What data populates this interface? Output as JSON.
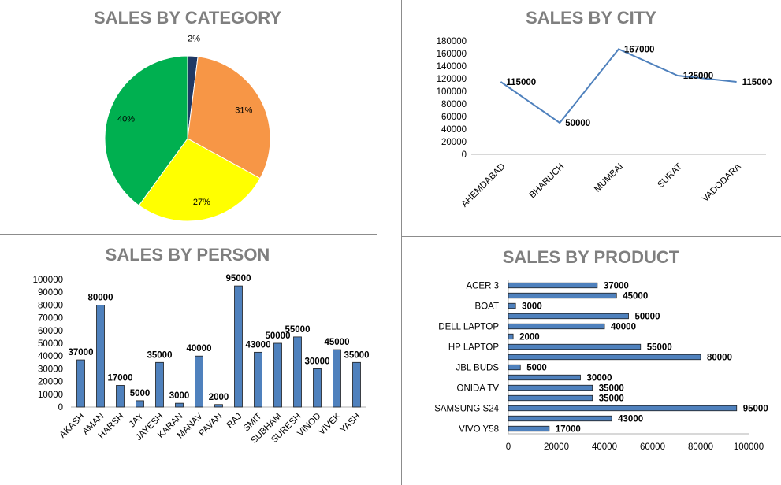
{
  "charts": {
    "category": {
      "title": "SALES BY CATEGORY",
      "slices": [
        {
          "percent": 2,
          "label": "2%",
          "color": "#1f3864"
        },
        {
          "percent": 31,
          "label": "31%",
          "color": "#f79646"
        },
        {
          "percent": 27,
          "label": "27%",
          "color": "#ffff00"
        },
        {
          "percent": 40,
          "label": "40%",
          "color": "#00b050"
        }
      ]
    },
    "city": {
      "title": "SALES BY CITY",
      "ylim": [
        0,
        180000
      ],
      "yticks": [
        "0",
        "20000",
        "40000",
        "60000",
        "80000",
        "100000",
        "120000",
        "140000",
        "160000",
        "180000"
      ],
      "categories": [
        "AHEMDABAD",
        "BHARUCH",
        "MUMBAI",
        "SURAT",
        "VADODARA"
      ],
      "values": [
        115000,
        50000,
        167000,
        125000,
        115000
      ],
      "labels": [
        "115000",
        "50000",
        "167000",
        "125000",
        "115000"
      ],
      "line_color": "#4f81bd"
    },
    "person": {
      "title": "SALES BY PERSON",
      "ylim": [
        0,
        100000
      ],
      "yticks": [
        "0",
        "10000",
        "20000",
        "30000",
        "40000",
        "50000",
        "60000",
        "70000",
        "80000",
        "90000",
        "100000"
      ],
      "categories": [
        "AKASH",
        "AMAN",
        "HARSH",
        "JAY",
        "JAYESH",
        "KARAN",
        "MANAV",
        "PAVAN",
        "RAJ",
        "SMIT",
        "SUBHAM",
        "SURESH",
        "VINOD",
        "VIVEK",
        "YASH"
      ],
      "values": [
        37000,
        80000,
        17000,
        5000,
        35000,
        3000,
        40000,
        2000,
        95000,
        43000,
        50000,
        55000,
        30000,
        45000,
        35000
      ],
      "labels": [
        "37000",
        "80000",
        "17000",
        "5000",
        "35000",
        "3000",
        "40000",
        "2000",
        "95000",
        "43000",
        "50000",
        "55000",
        "30000",
        "45000",
        "35000"
      ],
      "bar_color": "#4f81bd"
    },
    "product": {
      "title": "SALES BY PRODUCT",
      "xlim": [
        0,
        100000
      ],
      "xticks": [
        "0",
        "20000",
        "40000",
        "60000",
        "80000",
        "100000"
      ],
      "rows": [
        {
          "label": "ACER 3",
          "value": 37000
        },
        {
          "label": "",
          "value": 45000
        },
        {
          "label": "BOAT",
          "value": 3000
        },
        {
          "label": "",
          "value": 50000
        },
        {
          "label": "DELL LAPTOP",
          "value": 40000
        },
        {
          "label": "",
          "value": 2000
        },
        {
          "label": "HP LAPTOP",
          "value": 55000
        },
        {
          "label": "",
          "value": 80000
        },
        {
          "label": "JBL BUDS",
          "value": 5000
        },
        {
          "label": "",
          "value": 30000
        },
        {
          "label": "ONIDA TV",
          "value": 35000
        },
        {
          "label": "",
          "value": 35000
        },
        {
          "label": "SAMSUNG S24",
          "value": 95000
        },
        {
          "label": "",
          "value": 43000
        },
        {
          "label": "VIVO Y58",
          "value": 17000
        }
      ],
      "value_labels": [
        "37000",
        "45000",
        "3000",
        "50000",
        "40000",
        "2000",
        "55000",
        "80000",
        "5000",
        "30000",
        "35000",
        "35000",
        "95000",
        "43000",
        "17000"
      ],
      "bar_color": "#4f81bd"
    }
  },
  "chart_data": [
    {
      "type": "pie",
      "title": "SALES BY CATEGORY",
      "values": [
        2,
        31,
        27,
        40
      ],
      "labels": [
        "2%",
        "31%",
        "27%",
        "40%"
      ]
    },
    {
      "type": "line",
      "title": "SALES BY CITY",
      "categories": [
        "AHEMDABAD",
        "BHARUCH",
        "MUMBAI",
        "SURAT",
        "VADODARA"
      ],
      "values": [
        115000,
        50000,
        167000,
        125000,
        115000
      ],
      "ylim": [
        0,
        180000
      ]
    },
    {
      "type": "bar",
      "title": "SALES BY PERSON",
      "categories": [
        "AKASH",
        "AMAN",
        "HARSH",
        "JAY",
        "JAYESH",
        "KARAN",
        "MANAV",
        "PAVAN",
        "RAJ",
        "SMIT",
        "SUBHAM",
        "SURESH",
        "VINOD",
        "VIVEK",
        "YASH"
      ],
      "values": [
        37000,
        80000,
        17000,
        5000,
        35000,
        3000,
        40000,
        2000,
        95000,
        43000,
        50000,
        55000,
        30000,
        45000,
        35000
      ],
      "ylim": [
        0,
        100000
      ]
    },
    {
      "type": "bar",
      "orientation": "horizontal",
      "title": "SALES BY PRODUCT",
      "categories": [
        "ACER 3",
        "",
        "BOAT",
        "",
        "DELL LAPTOP",
        "",
        "HP LAPTOP",
        "",
        "JBL BUDS",
        "",
        "ONIDA TV",
        "",
        "SAMSUNG S24",
        "",
        "VIVO Y58"
      ],
      "values": [
        37000,
        45000,
        3000,
        50000,
        40000,
        2000,
        55000,
        80000,
        5000,
        30000,
        35000,
        35000,
        95000,
        43000,
        17000
      ],
      "xlim": [
        0,
        100000
      ]
    }
  ]
}
